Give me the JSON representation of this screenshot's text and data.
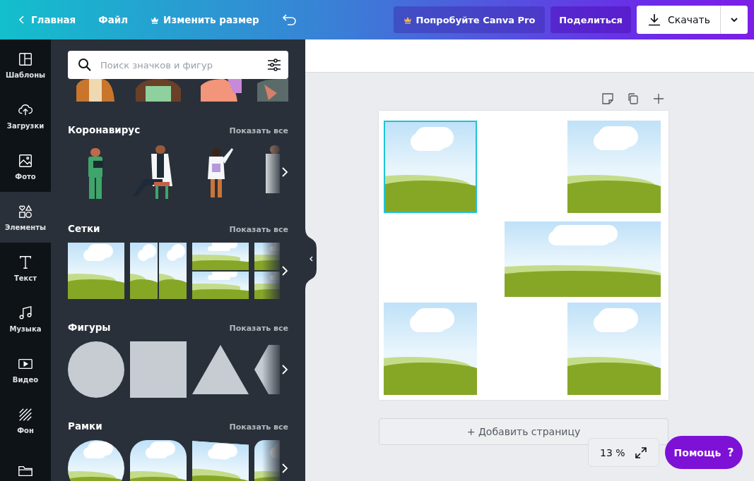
{
  "topbar": {
    "back": "Главная",
    "file": "Файл",
    "resize": "Изменить размер",
    "pro": "Попробуйте Canva Pro",
    "share": "Поделиться",
    "download": "Скачать"
  },
  "rail": [
    {
      "kind": "templates",
      "label": "Шаблоны",
      "selected": false
    },
    {
      "kind": "uploads",
      "label": "Загрузки",
      "selected": false
    },
    {
      "kind": "photos",
      "label": "Фото",
      "selected": false
    },
    {
      "kind": "elements",
      "label": "Элементы",
      "selected": true
    },
    {
      "kind": "text",
      "label": "Текст",
      "selected": false
    },
    {
      "kind": "music",
      "label": "Музыка",
      "selected": false
    },
    {
      "kind": "video",
      "label": "Видео",
      "selected": false
    },
    {
      "kind": "background",
      "label": "Фон",
      "selected": false
    },
    {
      "kind": "folder",
      "selected": false
    }
  ],
  "search": {
    "placeholder": "Поиск значков и фигур"
  },
  "sections": [
    {
      "kind": "people",
      "title": "Коронавирус",
      "show_all": "Показать все"
    },
    {
      "kind": "grids",
      "title": "Сетки",
      "show_all": "Показать все"
    },
    {
      "kind": "shapes",
      "title": "Фигуры",
      "show_all": "Показать все"
    },
    {
      "kind": "frames",
      "title": "Рамки",
      "show_all": "Показать все"
    }
  ],
  "page": {
    "images": [
      {
        "selected": true
      },
      {
        "selected": false
      },
      {
        "selected": false
      },
      {
        "selected": false
      },
      {
        "selected": false
      }
    ],
    "add_page": "+ Добавить страницу"
  },
  "zoom": "13 %",
  "help": {
    "label": "Помощь",
    "mark": "?"
  }
}
